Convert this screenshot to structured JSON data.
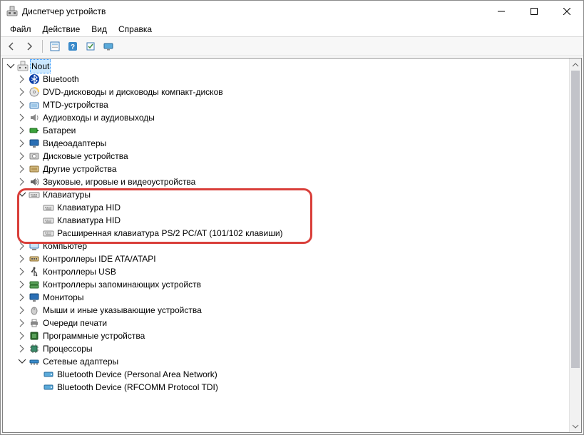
{
  "window": {
    "title": "Диспетчер устройств"
  },
  "menu": {
    "file": "Файл",
    "action": "Действие",
    "view": "Вид",
    "help": "Справка"
  },
  "tree": {
    "root": "Nout",
    "items": [
      {
        "label": "Bluetooth",
        "icon": "bluetooth",
        "state": "collapsed"
      },
      {
        "label": "DVD-дисководы и дисководы компакт-дисков",
        "icon": "dvd",
        "state": "collapsed"
      },
      {
        "label": "MTD-устройства",
        "icon": "mtd",
        "state": "collapsed"
      },
      {
        "label": "Аудиовходы и аудиовыходы",
        "icon": "audio",
        "state": "collapsed"
      },
      {
        "label": "Батареи",
        "icon": "battery",
        "state": "collapsed"
      },
      {
        "label": "Видеоадаптеры",
        "icon": "display",
        "state": "collapsed"
      },
      {
        "label": "Дисковые устройства",
        "icon": "disk",
        "state": "collapsed"
      },
      {
        "label": "Другие устройства",
        "icon": "other",
        "state": "collapsed"
      },
      {
        "label": "Звуковые, игровые и видеоустройства",
        "icon": "sound",
        "state": "collapsed"
      },
      {
        "label": "Клавиатуры",
        "icon": "keyboard",
        "state": "expanded",
        "children": [
          {
            "label": "Клавиатура HID",
            "icon": "keyboard"
          },
          {
            "label": "Клавиатура HID",
            "icon": "keyboard"
          },
          {
            "label": "Расширенная клавиатура PS/2 PC/AT (101/102 клавиши)",
            "icon": "keyboard"
          }
        ]
      },
      {
        "label": "Компьютер",
        "icon": "computer",
        "state": "collapsed"
      },
      {
        "label": "Контроллеры IDE ATA/ATAPI",
        "icon": "ide",
        "state": "collapsed"
      },
      {
        "label": "Контроллеры USB",
        "icon": "usb",
        "state": "collapsed"
      },
      {
        "label": "Контроллеры запоминающих устройств",
        "icon": "storage",
        "state": "collapsed"
      },
      {
        "label": "Мониторы",
        "icon": "monitor",
        "state": "collapsed"
      },
      {
        "label": "Мыши и иные указывающие устройства",
        "icon": "mouse",
        "state": "collapsed"
      },
      {
        "label": "Очереди печати",
        "icon": "print",
        "state": "collapsed"
      },
      {
        "label": "Программные устройства",
        "icon": "software",
        "state": "collapsed"
      },
      {
        "label": "Процессоры",
        "icon": "cpu",
        "state": "collapsed"
      },
      {
        "label": "Сетевые адаптеры",
        "icon": "network",
        "state": "expanded",
        "children": [
          {
            "label": "Bluetooth Device (Personal Area Network)",
            "icon": "netadapter"
          },
          {
            "label": "Bluetooth Device (RFCOMM Protocol TDI)",
            "icon": "netadapter"
          }
        ]
      }
    ]
  }
}
